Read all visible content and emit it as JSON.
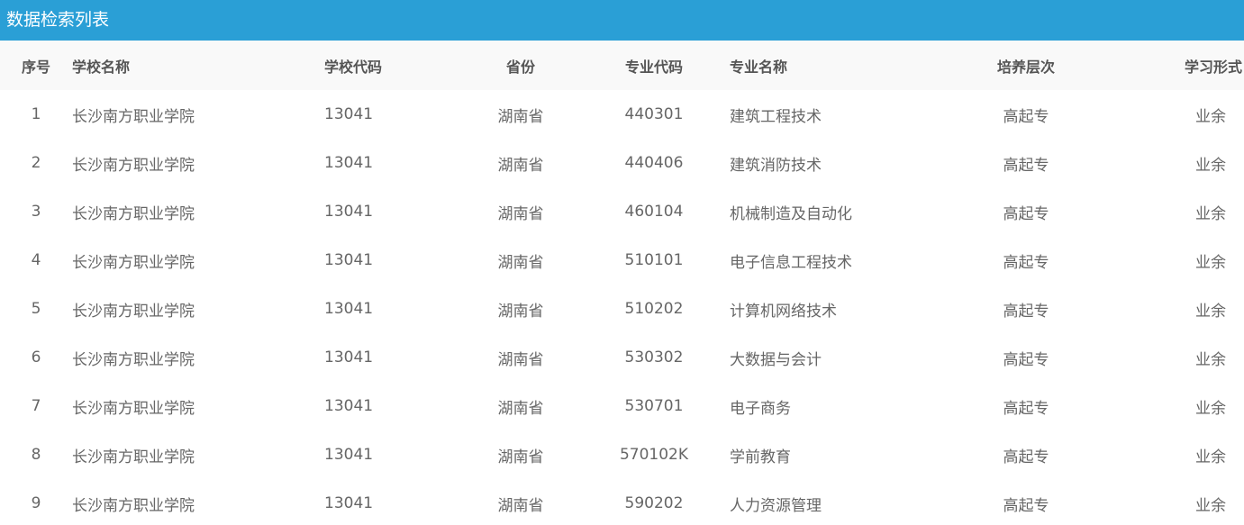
{
  "panel": {
    "title": "数据检索列表"
  },
  "table": {
    "headers": {
      "index": "序号",
      "school_name": "学校名称",
      "school_code": "学校代码",
      "province": "省份",
      "major_code": "专业代码",
      "major_name": "专业名称",
      "level": "培养层次",
      "study_form": "学习形式"
    },
    "rows": [
      {
        "index": "1",
        "school_name": "长沙南方职业学院",
        "school_code": "13041",
        "province": "湖南省",
        "major_code": "440301",
        "major_name": "建筑工程技术",
        "level": "高起专",
        "study_form": "业余"
      },
      {
        "index": "2",
        "school_name": "长沙南方职业学院",
        "school_code": "13041",
        "province": "湖南省",
        "major_code": "440406",
        "major_name": "建筑消防技术",
        "level": "高起专",
        "study_form": "业余"
      },
      {
        "index": "3",
        "school_name": "长沙南方职业学院",
        "school_code": "13041",
        "province": "湖南省",
        "major_code": "460104",
        "major_name": "机械制造及自动化",
        "level": "高起专",
        "study_form": "业余"
      },
      {
        "index": "4",
        "school_name": "长沙南方职业学院",
        "school_code": "13041",
        "province": "湖南省",
        "major_code": "510101",
        "major_name": "电子信息工程技术",
        "level": "高起专",
        "study_form": "业余"
      },
      {
        "index": "5",
        "school_name": "长沙南方职业学院",
        "school_code": "13041",
        "province": "湖南省",
        "major_code": "510202",
        "major_name": "计算机网络技术",
        "level": "高起专",
        "study_form": "业余"
      },
      {
        "index": "6",
        "school_name": "长沙南方职业学院",
        "school_code": "13041",
        "province": "湖南省",
        "major_code": "530302",
        "major_name": "大数据与会计",
        "level": "高起专",
        "study_form": "业余"
      },
      {
        "index": "7",
        "school_name": "长沙南方职业学院",
        "school_code": "13041",
        "province": "湖南省",
        "major_code": "530701",
        "major_name": "电子商务",
        "level": "高起专",
        "study_form": "业余"
      },
      {
        "index": "8",
        "school_name": "长沙南方职业学院",
        "school_code": "13041",
        "province": "湖南省",
        "major_code": "570102K",
        "major_name": "学前教育",
        "level": "高起专",
        "study_form": "业余"
      },
      {
        "index": "9",
        "school_name": "长沙南方职业学院",
        "school_code": "13041",
        "province": "湖南省",
        "major_code": "590202",
        "major_name": "人力资源管理",
        "level": "高起专",
        "study_form": "业余"
      }
    ]
  }
}
